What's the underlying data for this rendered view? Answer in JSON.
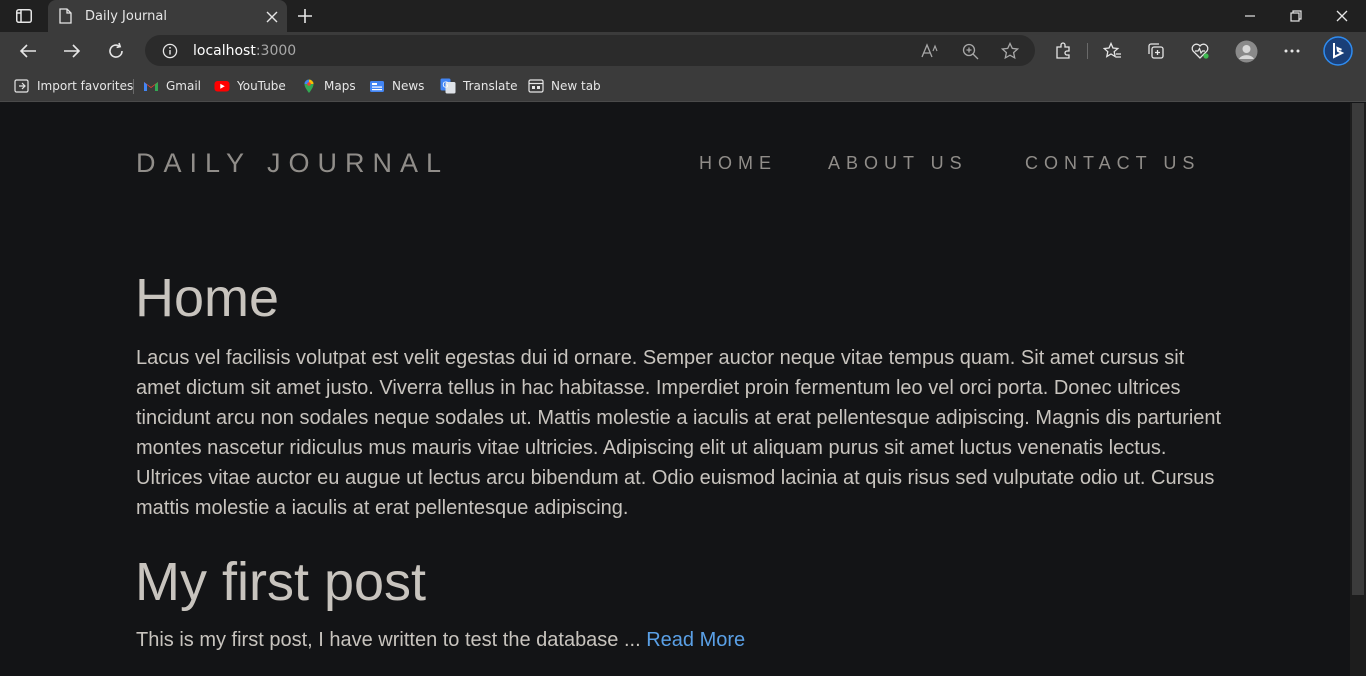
{
  "browser": {
    "tab_title": "Daily Journal",
    "url_host": "localhost",
    "url_port": ":3000",
    "bookmarks": [
      {
        "label": "Import favorites",
        "icon": "import-favorites-icon"
      },
      {
        "label": "Gmail",
        "icon": "gmail-icon"
      },
      {
        "label": "YouTube",
        "icon": "youtube-icon"
      },
      {
        "label": "Maps",
        "icon": "maps-icon"
      },
      {
        "label": "News",
        "icon": "news-icon"
      },
      {
        "label": "Translate",
        "icon": "translate-icon"
      },
      {
        "label": "New tab",
        "icon": "new-tab-icon"
      }
    ]
  },
  "site": {
    "brand": "DAILY JOURNAL",
    "nav": {
      "home": "HOME",
      "about": "ABOUT US",
      "contact": "CONTACT US"
    },
    "home": {
      "heading": "Home",
      "text": "Lacus vel facilisis volutpat est velit egestas dui id ornare. Semper auctor neque vitae tempus quam. Sit amet cursus sit amet dictum sit amet justo. Viverra tellus in hac habitasse. Imperdiet proin fermentum leo vel orci porta. Donec ultrices tincidunt arcu non sodales neque sodales ut. Mattis molestie a iaculis at erat pellentesque adipiscing. Magnis dis parturient montes nascetur ridiculus mus mauris vitae ultricies. Adipiscing elit ut aliquam purus sit amet luctus venenatis lectus. Ultrices vitae auctor eu augue ut lectus arcu bibendum at. Odio euismod lacinia at quis risus sed vulputate odio ut. Cursus mattis molestie a iaculis at erat pellentesque adipiscing."
    },
    "posts": [
      {
        "title": "My first post",
        "excerpt": "This is my first post, I have written to test the database ... ",
        "read_more": "Read More"
      }
    ]
  },
  "colors": {
    "page_bg": "#131416",
    "brand_nav": "#908d89",
    "body_text": "#c8c4be",
    "link": "#5aa0e6"
  }
}
